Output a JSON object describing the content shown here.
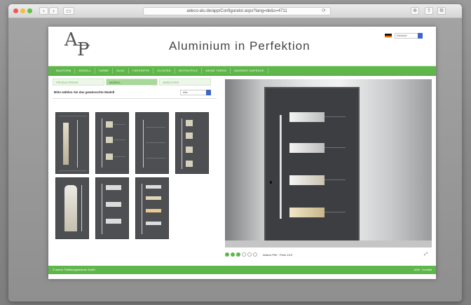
{
  "browser": {
    "url": "adeco-alu.de/app/Configurator.aspx?lang=de&s=4711",
    "reload_glyph": "⟳",
    "back_glyph": "‹",
    "forward_glyph": "›",
    "sidebar_glyph": "▭",
    "share_glyph": "⇪",
    "tabs_glyph": "⧉",
    "download_glyph": "⊕"
  },
  "site": {
    "logo_a": "A",
    "logo_p": "P",
    "tagline": "Aluminium in Perfektion",
    "language": "Deutsch",
    "nav": [
      "BAUFORM",
      "MODELL",
      "FARBE",
      "GLAS",
      "TÜRGRIFFE",
      "ZUTATEN",
      "SEITENTEILE",
      "MEINE TÜREN",
      "ANGEBOT ANFRAGE"
    ],
    "steps": [
      "PRODUKTREIHE",
      "MODELL",
      "ANSICHTEN"
    ],
    "prompt": "Bitte wählen Sie das gewünschte Modell",
    "sort_value": "Alle",
    "viewer_left_label": "",
    "viewer_right_label": "",
    "door_info": "Aldeco P50 · Preis 1/10",
    "fullscreen_glyph": "⤢",
    "footer_left": "© adeco Türfüllungstechnik GmbH",
    "footer_right": "AGB · Kontakt"
  },
  "colors": {
    "brand_green": "#5fb64a",
    "door_dark": "#4e4f52",
    "glass": "#d6d0bd"
  }
}
